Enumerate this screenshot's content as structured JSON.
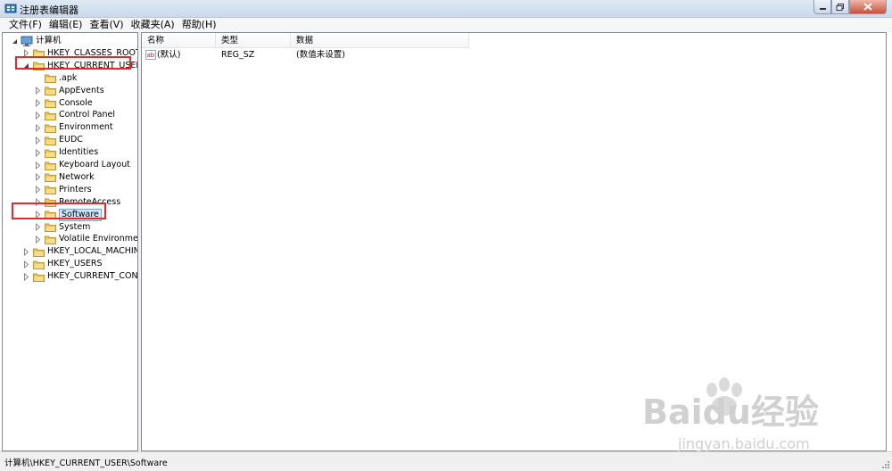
{
  "window": {
    "title": "注册表编辑器"
  },
  "menu": [
    "文件(F)",
    "编辑(E)",
    "查看(V)",
    "收藏夹(A)",
    "帮助(H)"
  ],
  "tree": [
    {
      "label": "计算机",
      "level": 0,
      "expander": "expanded",
      "icon": "computer-icon"
    },
    {
      "label": "HKEY_CLASSES_ROOT",
      "level": 1,
      "expander": "collapsed",
      "icon": "folder-icon"
    },
    {
      "label": "HKEY_CURRENT_USER",
      "level": 1,
      "expander": "expanded",
      "icon": "folder-icon",
      "highlighted": true
    },
    {
      "label": ".apk",
      "level": 2,
      "expander": "none",
      "icon": "folder-icon"
    },
    {
      "label": "AppEvents",
      "level": 2,
      "expander": "collapsed",
      "icon": "folder-icon"
    },
    {
      "label": "Console",
      "level": 2,
      "expander": "collapsed",
      "icon": "folder-icon"
    },
    {
      "label": "Control Panel",
      "level": 2,
      "expander": "collapsed",
      "icon": "folder-icon"
    },
    {
      "label": "Environment",
      "level": 2,
      "expander": "collapsed",
      "icon": "folder-icon"
    },
    {
      "label": "EUDC",
      "level": 2,
      "expander": "collapsed",
      "icon": "folder-icon"
    },
    {
      "label": "Identities",
      "level": 2,
      "expander": "collapsed",
      "icon": "folder-icon"
    },
    {
      "label": "Keyboard Layout",
      "level": 2,
      "expander": "collapsed",
      "icon": "folder-icon"
    },
    {
      "label": "Network",
      "level": 2,
      "expander": "collapsed",
      "icon": "folder-icon"
    },
    {
      "label": "Printers",
      "level": 2,
      "expander": "collapsed",
      "icon": "folder-icon"
    },
    {
      "label": "RemoteAccess",
      "level": 2,
      "expander": "collapsed",
      "icon": "folder-icon"
    },
    {
      "label": "Software",
      "level": 2,
      "expander": "collapsed",
      "icon": "folder-icon",
      "selected": true,
      "highlighted": true
    },
    {
      "label": "System",
      "level": 2,
      "expander": "collapsed",
      "icon": "folder-icon"
    },
    {
      "label": "Volatile Environment",
      "level": 2,
      "expander": "collapsed",
      "icon": "folder-icon"
    },
    {
      "label": "HKEY_LOCAL_MACHINE",
      "level": 1,
      "expander": "collapsed",
      "icon": "folder-icon"
    },
    {
      "label": "HKEY_USERS",
      "level": 1,
      "expander": "collapsed",
      "icon": "folder-icon"
    },
    {
      "label": "HKEY_CURRENT_CONFIG",
      "level": 1,
      "expander": "collapsed",
      "icon": "folder-icon"
    }
  ],
  "columns": [
    "名称",
    "类型",
    "数据"
  ],
  "values": [
    {
      "name": "(默认)",
      "type": "REG_SZ",
      "data": "(数值未设置)",
      "icon": "string-value-icon"
    }
  ],
  "status": {
    "path": "计算机\\HKEY_CURRENT_USER\\Software"
  },
  "watermark": {
    "brand": "Baidu经验",
    "url": "jingyan.baidu.com"
  },
  "colors": {
    "highlight_box": "#e8262f",
    "selection": "#cde8ff",
    "folder": "#e8c25a"
  }
}
